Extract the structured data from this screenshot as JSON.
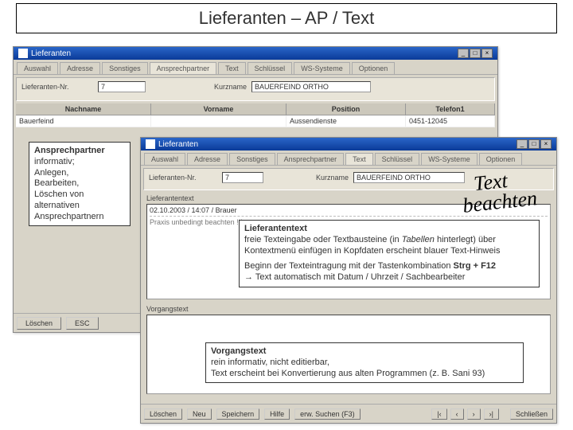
{
  "slide": {
    "title": "Lieferanten – AP / Text"
  },
  "win1": {
    "title": "Lieferanten",
    "tabs": [
      "Auswahl",
      "Adresse",
      "Sonstiges",
      "Ansprechpartner",
      "Text",
      "Schlüssel",
      "WS-Systeme",
      "Optionen"
    ],
    "active_tab_index": 3,
    "fields": {
      "lieferanten_nr_label": "Lieferanten-Nr.",
      "lieferanten_nr": "7",
      "kurzname_label": "Kurzname",
      "kurzname": "BAUERFEIND ORTHO"
    },
    "grid": {
      "headers": [
        "Nachname",
        "Vorname",
        "Position",
        "Telefon1"
      ],
      "row": {
        "nachname": "Bauerfeind",
        "vorname": "",
        "position": "Aussendienste",
        "telefon1": "0451-12045"
      }
    },
    "buttons": {
      "loeschen": "Löschen",
      "esc": "ESC"
    },
    "winbtns": {
      "min": "_",
      "max": "□",
      "close": "×"
    }
  },
  "win2": {
    "title": "Lieferanten",
    "tabs": [
      "Auswahl",
      "Adresse",
      "Sonstiges",
      "Ansprechpartner",
      "Text",
      "Schlüssel",
      "WS-Systeme",
      "Optionen"
    ],
    "active_tab_index": 4,
    "fields": {
      "lieferanten_nr_label": "Lieferanten-Nr.",
      "lieferanten_nr": "7",
      "kurzname_label": "Kurzname",
      "kurzname": "BAUERFEIND ORTHO"
    },
    "textblock": {
      "lieferantentext_label": "Lieferantentext",
      "line1": "02.10.2003 / 14:07 / Brauer",
      "line2": "Praxis unbedingt beachten !!!"
    },
    "vorgang_label": "Vorgangstext",
    "buttons": {
      "loeschen": "Löschen",
      "neu": "Neu",
      "speichern": "Speichern",
      "hilfe": "Hilfe",
      "erw_suchen": "erw. Suchen (F3)",
      "nav_first": "|‹",
      "nav_prev": "‹",
      "nav_next": "›",
      "nav_last": "›|",
      "schliessen": "Schließen"
    },
    "winbtns": {
      "min": "_",
      "max": "□",
      "close": "×"
    }
  },
  "callouts": {
    "ap": {
      "title": "Ansprechpartner",
      "body": "informativ;\nAnlegen,\nBearbeiten,\nLöschen von\nalternativen\nAnsprechpartnern"
    },
    "lt": {
      "title": "Lieferantentext",
      "body1": "freie Texteingabe oder Textbausteine (in ",
      "body1_i": "Tabellen",
      "body1_tail": " hinterlegt) über Kontextmenü einfügen in Kopfdaten erscheint blauer Text-Hinweis",
      "body2_pre": "Beginn der Texteintragung mit der Tastenkombination ",
      "body2_b": "Strg + F12",
      "body2_tail": " → Text automatisch mit Datum / Uhrzeit / Sachbearbeiter"
    },
    "vt": {
      "title": "Vorgangstext",
      "body": "rein informativ, nicht editierbar,\nText erscheint bei Konvertierung aus alten Programmen (z. B. Sani 93)"
    }
  },
  "stamp": {
    "line1": "Text",
    "line2": "beachten"
  }
}
